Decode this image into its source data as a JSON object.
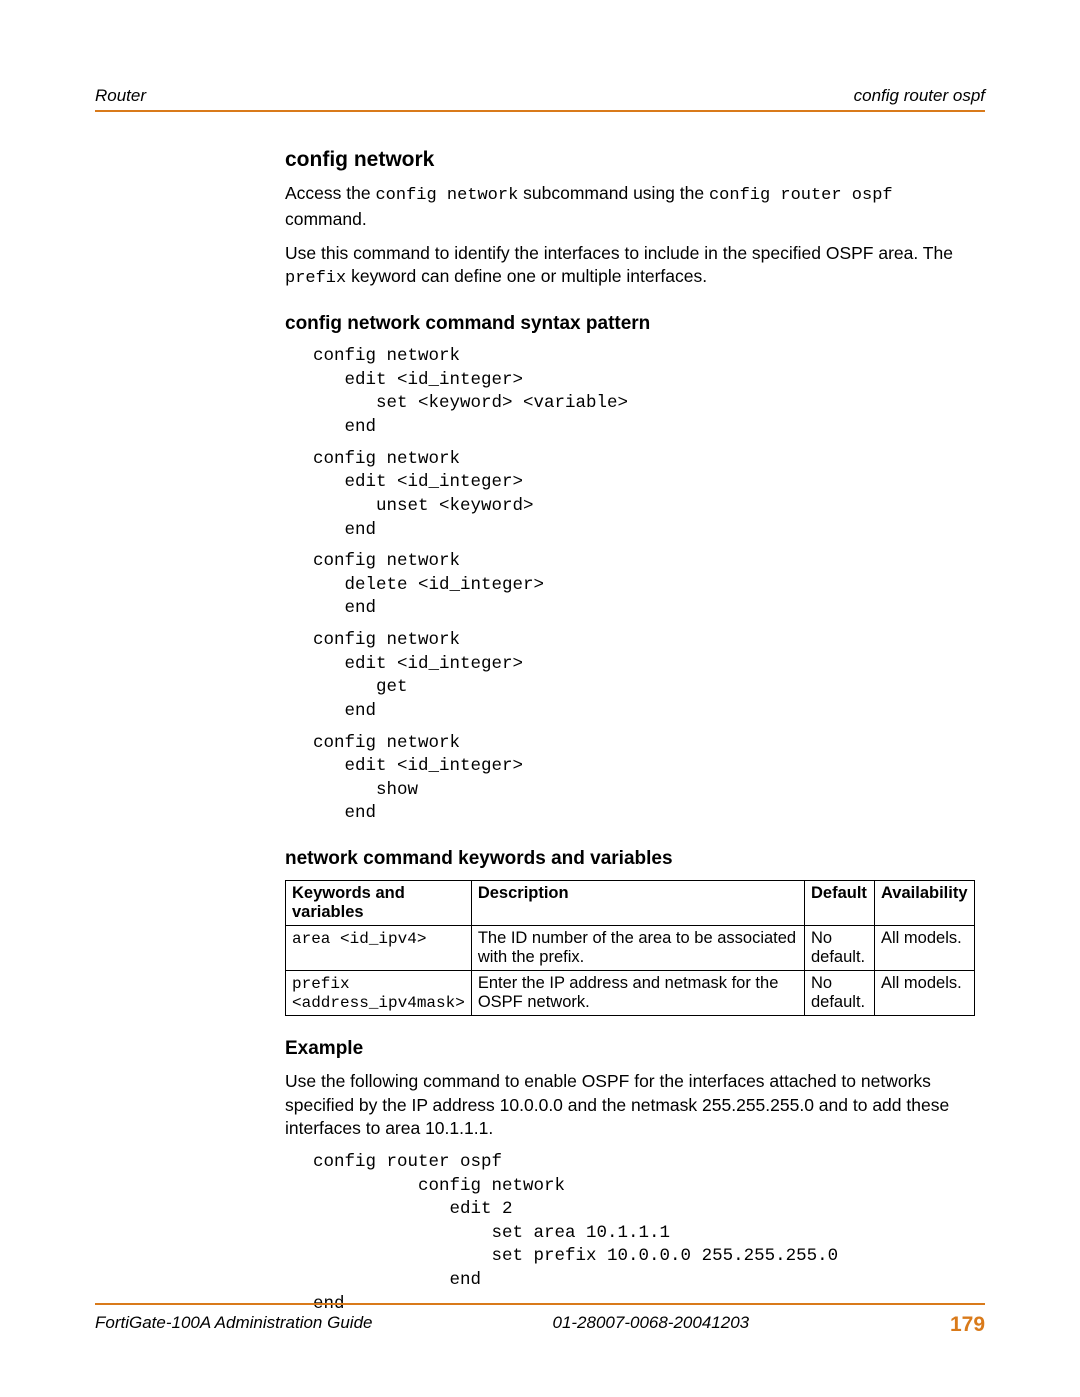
{
  "header": {
    "left": "Router",
    "right": "config router ospf"
  },
  "section": {
    "title": "config network",
    "p1_pre": "Access the ",
    "p1_code1": "config network",
    "p1_mid": " subcommand using the ",
    "p1_code2": "config router ospf",
    "p1_end": " command.",
    "p2_pre": "Use this command to identify the interfaces to include in the specified OSPF area. The ",
    "p2_code": "prefix",
    "p2_end": " keyword can define one or multiple interfaces."
  },
  "syntax": {
    "title": "config network command syntax pattern",
    "block1": "config network\n   edit <id_integer>\n      set <keyword> <variable>\n   end",
    "block2": "config network\n   edit <id_integer>\n      unset <keyword>\n   end",
    "block3": "config network\n   delete <id_integer>\n   end",
    "block4": "config network\n   edit <id_integer>\n      get\n   end",
    "block5": "config network\n   edit <id_integer>\n      show\n   end"
  },
  "table": {
    "title": "network command keywords and variables",
    "headers": {
      "kw": "Keywords and variables",
      "desc": "Description",
      "def": "Default",
      "avail": "Availability"
    },
    "rows": [
      {
        "kw": "area <id_ipv4>",
        "desc": "The ID number of the area to be associated with the prefix.",
        "def": "No default.",
        "avail": "All models."
      },
      {
        "kw_line1": "prefix",
        "kw_line2": "<address_ipv4mask>",
        "desc": "Enter the IP address and netmask for the OSPF network.",
        "def": "No default.",
        "avail": "All models."
      }
    ]
  },
  "example": {
    "title": "Example",
    "para": "Use the following command to enable OSPF for the interfaces attached to networks specified by the IP address 10.0.0.0 and the netmask 255.255.255.0 and to add these interfaces to area 10.1.1.1.",
    "code": "config router ospf\n          config network\n             edit 2\n                 set area 10.1.1.1\n                 set prefix 10.0.0.0 255.255.255.0\n             end\nend"
  },
  "footer": {
    "left": "FortiGate-100A Administration Guide",
    "mid": "01-28007-0068-20041203",
    "page": "179"
  }
}
